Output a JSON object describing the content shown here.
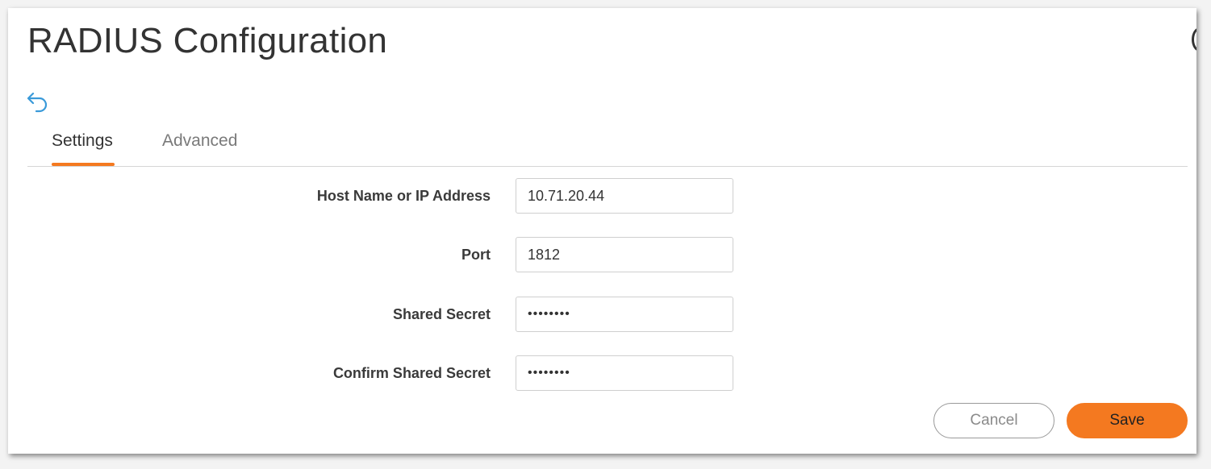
{
  "page": {
    "title": "RADIUS Configuration"
  },
  "tabs": [
    {
      "label": "Settings",
      "active": true
    },
    {
      "label": "Advanced",
      "active": false
    }
  ],
  "form": {
    "host": {
      "label": "Host Name or IP Address",
      "value": "10.71.20.44"
    },
    "port": {
      "label": "Port",
      "value": "1812"
    },
    "shared_secret": {
      "label": "Shared Secret",
      "value": "••••••••"
    },
    "confirm_shared_secret": {
      "label": "Confirm Shared Secret",
      "value": "••••••••"
    }
  },
  "actions": {
    "cancel_label": "Cancel",
    "save_label": "Save"
  },
  "colors": {
    "accent": "#f47920",
    "back_icon": "#3a9ad9"
  },
  "icons": {
    "back": "back-arrow-icon"
  }
}
